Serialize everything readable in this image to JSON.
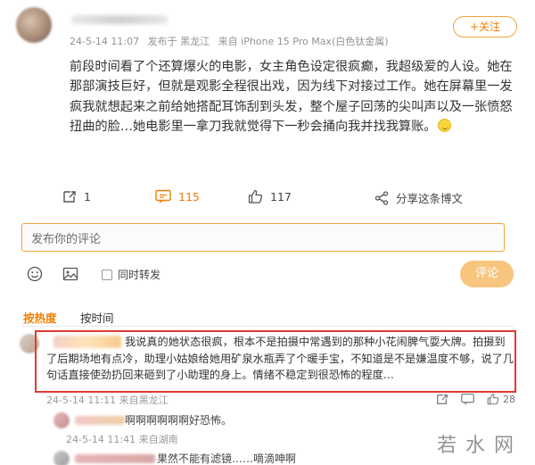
{
  "post": {
    "meta": {
      "date": "24-5-14 11:07",
      "location": "发布于 黑龙江",
      "device": "来自 iPhone 15 Pro Max(白色钛金属)"
    },
    "follow_label": "+关注",
    "text": "前段时间看了个还算爆火的电影，女主角色设定很疯癫，我超级爱的人设。她在那部演技巨好，但就是观影全程很出戏，因为线下对接过工作。她在屏幕里一发疯我就想起来之前给她搭配耳饰刮到头发，整个屋子回荡的尖叫声以及一张愤怒扭曲的脸…她电影里一拿刀我就觉得下一秒会捅向我并找我算账。"
  },
  "actions": {
    "repost_count": "1",
    "comment_count": "115",
    "like_count": "117",
    "share_label": "分享这条博文"
  },
  "composer": {
    "placeholder": "发布你的评论",
    "repost_label": "同时转发",
    "submit_label": "评论"
  },
  "sort": {
    "hot_label": "按热度",
    "time_label": "按时间"
  },
  "comments": [
    {
      "text": "我说真的她状态很疯，根本不是拍摄中常遇到的那种小花闹脾气耍大牌。拍摄到了后期场地有点冷，助理小姑娘给她用矿泉水瓶弄了个暖手宝，不知道是不是嫌温度不够，说了几句话直接使劲扔回来砸到了小助理的身上。情绪不稳定到很恐怖的程度…",
      "meta": "24-5-14 11:11 来自黑龙江",
      "like_count": "28"
    }
  ],
  "replies": [
    {
      "text": "啊啊啊啊啊啊好恐怖。",
      "meta": "24-5-14 11:41 来自湖南"
    },
    {
      "text": "果然不能有滤镜……嘀滴呻啊"
    }
  ],
  "watermark": "若水网",
  "colors": {
    "accent": "#f07f00",
    "highlight_frame": "#e03a32",
    "submit_disabled": "#f8c57e"
  }
}
